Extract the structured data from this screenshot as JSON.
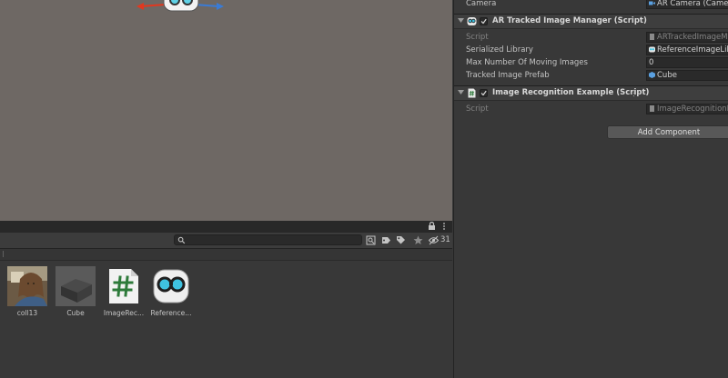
{
  "colors": {
    "scene_bg": "#6e6864",
    "panel_bg": "#383838",
    "inspector_bg": "#383838",
    "accent_x": "#e1381f",
    "accent_z": "#3a7bd5"
  },
  "project": {
    "search": {
      "value": "",
      "placeholder": ""
    },
    "hidden_count": "31",
    "assets": [
      {
        "name": "coll13",
        "icon": "texture-thumbnail"
      },
      {
        "name": "Cube",
        "icon": "prefab-cube-thumbnail"
      },
      {
        "name": "ImageRec...",
        "icon": "csharp-script-icon"
      },
      {
        "name": "Reference...",
        "icon": "reference-image-library-icon"
      }
    ]
  },
  "inspector": {
    "camera_row": {
      "label": "Camera",
      "value": "AR Camera (Camera)"
    },
    "tracked_manager": {
      "title": "AR Tracked Image Manager (Script)",
      "fields": [
        {
          "label": "Script",
          "value": "ARTrackedImageManager",
          "dim": true
        },
        {
          "label": "Serialized Library",
          "value": "ReferenceImageLibrary"
        },
        {
          "label": "Max Number Of Moving Images",
          "value": "0"
        },
        {
          "label": "Tracked Image Prefab",
          "value": "Cube"
        }
      ]
    },
    "recognition": {
      "title": "Image Recognition Example (Script)",
      "fields": [
        {
          "label": "Script",
          "value": "ImageRecognitionExample",
          "dim": true
        }
      ]
    },
    "add_component_label": "Add Component"
  }
}
